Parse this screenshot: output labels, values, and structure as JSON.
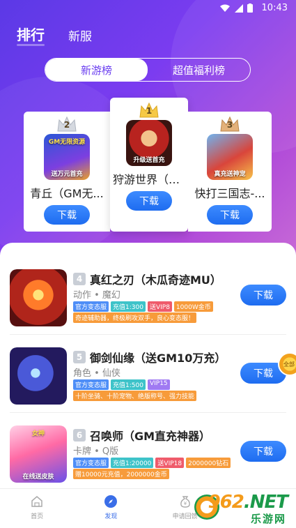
{
  "status_bar": {
    "time": "10:43"
  },
  "top_tabs": [
    {
      "label": "排行",
      "active": true
    },
    {
      "label": "新服",
      "active": false
    }
  ],
  "segment": [
    {
      "label": "新游榜",
      "active": true
    },
    {
      "label": "超值福利榜",
      "active": false
    }
  ],
  "podium": {
    "first": {
      "rank": "1",
      "name": "狩游世界（天...",
      "icon_text": "升级送首充",
      "button": "下载"
    },
    "second": {
      "rank": "2",
      "name": "青丘（GM无...",
      "icon_text_top": "GM无限资源",
      "icon_text": "送万元首充",
      "button": "下载"
    },
    "third": {
      "rank": "3",
      "name": "快打三国志-...",
      "icon_text": "真充送神宠",
      "button": "下载"
    }
  },
  "games": [
    {
      "rank": "4",
      "name": "真红之刃（木瓜奇迹MU）",
      "category": "动作 • 魔幻",
      "tags": [
        "官方变态服",
        "充值1:300",
        "送VIP8",
        "1000W金币"
      ],
      "desc": "奇迹辅助器，终极刷攻双手，良心变态服！",
      "button": "下载"
    },
    {
      "rank": "5",
      "name": "御剑仙缘（送GM10万充）",
      "category": "角色 • 仙侠",
      "tags": [
        "官方变态服",
        "充值1:500",
        "VIP15"
      ],
      "desc": "十阶坐骑、十阶宠物、绝版称号、强力技能",
      "button": "下载"
    },
    {
      "rank": "6",
      "name": "召唤师（GM直充神器）",
      "category": "卡牌 • Q版",
      "tags": [
        "官方变态服",
        "充值1:20000",
        "送VIP18",
        "2000000钻石"
      ],
      "desc": "赠10000元充值，2000000金币",
      "button": "下载",
      "icon_text": "在线送皮肤",
      "icon_text_top": "女神"
    }
  ],
  "float_ball": {
    "label": "全部"
  },
  "bottom_nav": [
    {
      "label": "首页",
      "icon": "home-icon",
      "active": false
    },
    {
      "label": "发现",
      "icon": "compass-icon",
      "active": true
    },
    {
      "label": "申请回馈",
      "icon": "money-bag-icon",
      "active": false
    },
    {
      "label": "",
      "icon": "",
      "active": false
    }
  ],
  "watermark": {
    "logo_a": "962",
    "logo_b": ".NET",
    "sub": "乐游网"
  },
  "colors": {
    "accent": "#6a3ef0",
    "button_blue": "#1e6cf0",
    "nav_active": "#3a6ee8"
  }
}
